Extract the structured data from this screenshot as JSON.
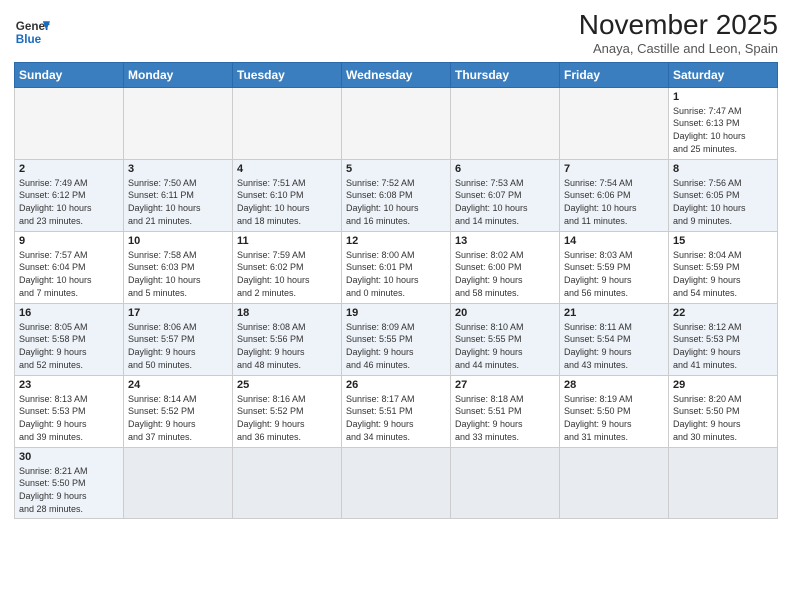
{
  "header": {
    "logo_text_general": "General",
    "logo_text_blue": "Blue",
    "month_title": "November 2025",
    "location": "Anaya, Castille and Leon, Spain"
  },
  "weekdays": [
    "Sunday",
    "Monday",
    "Tuesday",
    "Wednesday",
    "Thursday",
    "Friday",
    "Saturday"
  ],
  "weeks": [
    [
      {
        "day": "",
        "info": ""
      },
      {
        "day": "",
        "info": ""
      },
      {
        "day": "",
        "info": ""
      },
      {
        "day": "",
        "info": ""
      },
      {
        "day": "",
        "info": ""
      },
      {
        "day": "",
        "info": ""
      },
      {
        "day": "1",
        "info": "Sunrise: 7:47 AM\nSunset: 6:13 PM\nDaylight: 10 hours\nand 25 minutes."
      }
    ],
    [
      {
        "day": "2",
        "info": "Sunrise: 7:49 AM\nSunset: 6:12 PM\nDaylight: 10 hours\nand 23 minutes."
      },
      {
        "day": "3",
        "info": "Sunrise: 7:50 AM\nSunset: 6:11 PM\nDaylight: 10 hours\nand 21 minutes."
      },
      {
        "day": "4",
        "info": "Sunrise: 7:51 AM\nSunset: 6:10 PM\nDaylight: 10 hours\nand 18 minutes."
      },
      {
        "day": "5",
        "info": "Sunrise: 7:52 AM\nSunset: 6:08 PM\nDaylight: 10 hours\nand 16 minutes."
      },
      {
        "day": "6",
        "info": "Sunrise: 7:53 AM\nSunset: 6:07 PM\nDaylight: 10 hours\nand 14 minutes."
      },
      {
        "day": "7",
        "info": "Sunrise: 7:54 AM\nSunset: 6:06 PM\nDaylight: 10 hours\nand 11 minutes."
      },
      {
        "day": "8",
        "info": "Sunrise: 7:56 AM\nSunset: 6:05 PM\nDaylight: 10 hours\nand 9 minutes."
      }
    ],
    [
      {
        "day": "9",
        "info": "Sunrise: 7:57 AM\nSunset: 6:04 PM\nDaylight: 10 hours\nand 7 minutes."
      },
      {
        "day": "10",
        "info": "Sunrise: 7:58 AM\nSunset: 6:03 PM\nDaylight: 10 hours\nand 5 minutes."
      },
      {
        "day": "11",
        "info": "Sunrise: 7:59 AM\nSunset: 6:02 PM\nDaylight: 10 hours\nand 2 minutes."
      },
      {
        "day": "12",
        "info": "Sunrise: 8:00 AM\nSunset: 6:01 PM\nDaylight: 10 hours\nand 0 minutes."
      },
      {
        "day": "13",
        "info": "Sunrise: 8:02 AM\nSunset: 6:00 PM\nDaylight: 9 hours\nand 58 minutes."
      },
      {
        "day": "14",
        "info": "Sunrise: 8:03 AM\nSunset: 5:59 PM\nDaylight: 9 hours\nand 56 minutes."
      },
      {
        "day": "15",
        "info": "Sunrise: 8:04 AM\nSunset: 5:59 PM\nDaylight: 9 hours\nand 54 minutes."
      }
    ],
    [
      {
        "day": "16",
        "info": "Sunrise: 8:05 AM\nSunset: 5:58 PM\nDaylight: 9 hours\nand 52 minutes."
      },
      {
        "day": "17",
        "info": "Sunrise: 8:06 AM\nSunset: 5:57 PM\nDaylight: 9 hours\nand 50 minutes."
      },
      {
        "day": "18",
        "info": "Sunrise: 8:08 AM\nSunset: 5:56 PM\nDaylight: 9 hours\nand 48 minutes."
      },
      {
        "day": "19",
        "info": "Sunrise: 8:09 AM\nSunset: 5:55 PM\nDaylight: 9 hours\nand 46 minutes."
      },
      {
        "day": "20",
        "info": "Sunrise: 8:10 AM\nSunset: 5:55 PM\nDaylight: 9 hours\nand 44 minutes."
      },
      {
        "day": "21",
        "info": "Sunrise: 8:11 AM\nSunset: 5:54 PM\nDaylight: 9 hours\nand 43 minutes."
      },
      {
        "day": "22",
        "info": "Sunrise: 8:12 AM\nSunset: 5:53 PM\nDaylight: 9 hours\nand 41 minutes."
      }
    ],
    [
      {
        "day": "23",
        "info": "Sunrise: 8:13 AM\nSunset: 5:53 PM\nDaylight: 9 hours\nand 39 minutes."
      },
      {
        "day": "24",
        "info": "Sunrise: 8:14 AM\nSunset: 5:52 PM\nDaylight: 9 hours\nand 37 minutes."
      },
      {
        "day": "25",
        "info": "Sunrise: 8:16 AM\nSunset: 5:52 PM\nDaylight: 9 hours\nand 36 minutes."
      },
      {
        "day": "26",
        "info": "Sunrise: 8:17 AM\nSunset: 5:51 PM\nDaylight: 9 hours\nand 34 minutes."
      },
      {
        "day": "27",
        "info": "Sunrise: 8:18 AM\nSunset: 5:51 PM\nDaylight: 9 hours\nand 33 minutes."
      },
      {
        "day": "28",
        "info": "Sunrise: 8:19 AM\nSunset: 5:50 PM\nDaylight: 9 hours\nand 31 minutes."
      },
      {
        "day": "29",
        "info": "Sunrise: 8:20 AM\nSunset: 5:50 PM\nDaylight: 9 hours\nand 30 minutes."
      }
    ],
    [
      {
        "day": "30",
        "info": "Sunrise: 8:21 AM\nSunset: 5:50 PM\nDaylight: 9 hours\nand 28 minutes."
      },
      {
        "day": "",
        "info": ""
      },
      {
        "day": "",
        "info": ""
      },
      {
        "day": "",
        "info": ""
      },
      {
        "day": "",
        "info": ""
      },
      {
        "day": "",
        "info": ""
      },
      {
        "day": "",
        "info": ""
      }
    ]
  ]
}
